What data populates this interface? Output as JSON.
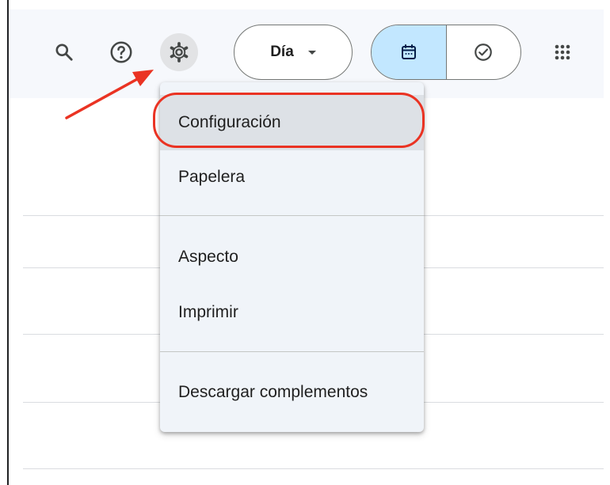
{
  "toolbar": {
    "icons": [
      "search-icon",
      "help-icon",
      "settings-gear-icon",
      "apps-grid-icon"
    ],
    "view_select": {
      "label": "Día"
    },
    "view_toggle": {
      "selected": "calendar",
      "options": [
        "calendar-icon",
        "tasks-check-icon"
      ]
    }
  },
  "settings_menu": {
    "items": [
      {
        "label": "Configuración",
        "highlighted": true
      },
      {
        "label": "Papelera"
      },
      {
        "label": "Aspecto"
      },
      {
        "label": "Imprimir"
      },
      {
        "label": "Descargar complementos"
      }
    ]
  },
  "colors": {
    "annotation_red": "#ea3323",
    "header_bg": "#f6f8fc",
    "selected_segment": "#c2e7ff",
    "menu_bg": "#f0f4f9"
  }
}
